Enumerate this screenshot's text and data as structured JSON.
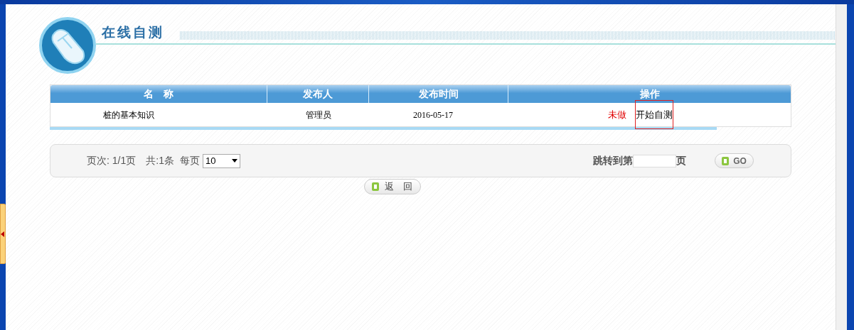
{
  "header": {
    "title": "在线自测"
  },
  "table": {
    "columns": [
      "名　称",
      "发布人",
      "发布时间",
      "操作"
    ],
    "rows": [
      {
        "name": "桩的基本知识",
        "publisher": "管理员",
        "date": "2016-05-17",
        "status": "未做",
        "action": "开始自测",
        "action_focused": true
      }
    ]
  },
  "pager": {
    "page_info": "页次: 1/1页",
    "total": "共:1条",
    "per_page_label": "每页",
    "per_page": "10",
    "jump_label": "跳转到第",
    "jump_suffix": "页",
    "go": "GO"
  },
  "back_button": "返　回"
}
